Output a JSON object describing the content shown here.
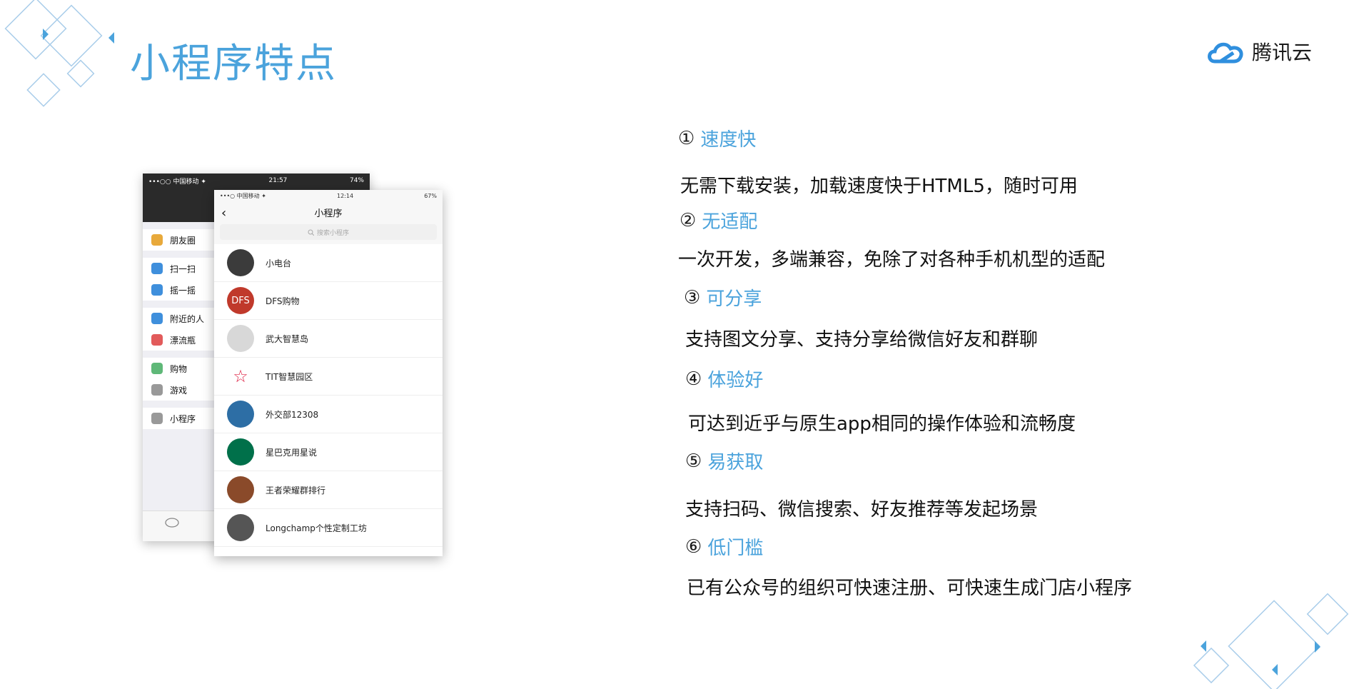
{
  "slide": {
    "title": "小程序特点"
  },
  "brand": {
    "name": "腾讯云",
    "icon": "cloud-logo-icon",
    "color": "#2f8fde"
  },
  "accent_color": "#4ba3dc",
  "phone_back": {
    "status_left": "•••○○ 中国移动 ✦",
    "status_time": "21:57",
    "status_right": "74%",
    "groups": [
      [
        {
          "label": "朋友圈",
          "icon": "moments-icon"
        }
      ],
      [
        {
          "label": "扫一扫",
          "icon": "scan-icon"
        },
        {
          "label": "摇一摇",
          "icon": "shake-icon"
        }
      ],
      [
        {
          "label": "附近的人",
          "icon": "nearby-icon"
        },
        {
          "label": "漂流瓶",
          "icon": "bottle-icon"
        }
      ],
      [
        {
          "label": "购物",
          "icon": "shopping-icon"
        },
        {
          "label": "游戏",
          "icon": "game-icon"
        }
      ],
      [
        {
          "label": "小程序",
          "icon": "miniprogram-icon"
        }
      ]
    ]
  },
  "phone_front": {
    "status_left": "•••○ 中国移动 ✦",
    "status_time": "12:14",
    "status_right": "67%",
    "title": "小程序",
    "search_placeholder": "搜索小程序",
    "items": [
      {
        "label": "小电台",
        "avatar_text": "",
        "color": "#3b3b3b"
      },
      {
        "label": "DFS购物",
        "avatar_text": "DFS",
        "color": "#c0392b"
      },
      {
        "label": "武大智慧岛",
        "avatar_text": "",
        "color": "#d8d8d8"
      },
      {
        "label": "TIT智慧园区",
        "avatar_text": "☆",
        "color": "#ffffff"
      },
      {
        "label": "外交部12308",
        "avatar_text": "",
        "color": "#2d6ea5"
      },
      {
        "label": "星巴克用星说",
        "avatar_text": "",
        "color": "#00704a"
      },
      {
        "label": "王者荣耀群排行",
        "avatar_text": "",
        "color": "#8a4a2a"
      },
      {
        "label": "Longchamp个性定制工坊",
        "avatar_text": "",
        "color": "#555555"
      }
    ]
  },
  "features": [
    {
      "num": "①",
      "title": "速度快",
      "desc": "无需下载安装，加载速度快于HTML5，随时可用"
    },
    {
      "num": "②",
      "title": "无适配",
      "desc": "一次开发，多端兼容，免除了对各种手机机型的适配"
    },
    {
      "num": "③",
      "title": "可分享",
      "desc": "支持图文分享、支持分享给微信好友和群聊"
    },
    {
      "num": "④",
      "title": "体验好",
      "desc": "可达到近乎与原生app相同的操作体验和流畅度"
    },
    {
      "num": "⑤",
      "title": "易获取",
      "desc": "支持扫码、微信搜索、好友推荐等发起场景"
    },
    {
      "num": "⑥",
      "title": "低门槛",
      "desc": "已有公众号的组织可快速注册、可快速生成门店小程序"
    }
  ]
}
